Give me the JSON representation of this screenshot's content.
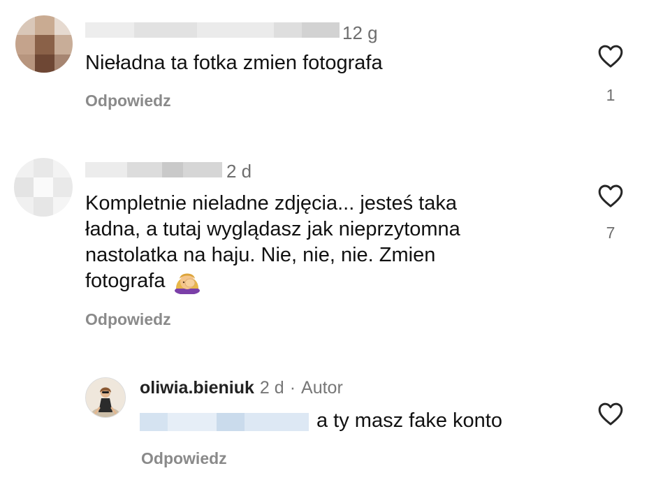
{
  "comments": [
    {
      "time": "12 g",
      "text": "Nieładna ta fotka zmien fotografa",
      "reply_label": "Odpowiedz",
      "likes": "1"
    },
    {
      "time": "2 d",
      "text_lines": [
        "Kompletnie nieladne zdjęcia... jesteś taka",
        "ładna, a tutaj wyglądasz jak nieprzytomna",
        "nastolatka na haju. Nie, nie, nie. Zmien",
        "fotografa"
      ],
      "emoji": "facepalm-woman-emoji",
      "reply_label": "Odpowiedz",
      "likes": "7"
    }
  ],
  "reply": {
    "username": "oliwia.bieniuk",
    "time": "2 d",
    "separator": "·",
    "badge": "Autor",
    "text": "a ty masz fake konto",
    "reply_label": "Odpowiedz"
  },
  "colors": {
    "meta_gray": "#8a8a8a",
    "text": "#111111",
    "heart_stroke": "#262626"
  }
}
